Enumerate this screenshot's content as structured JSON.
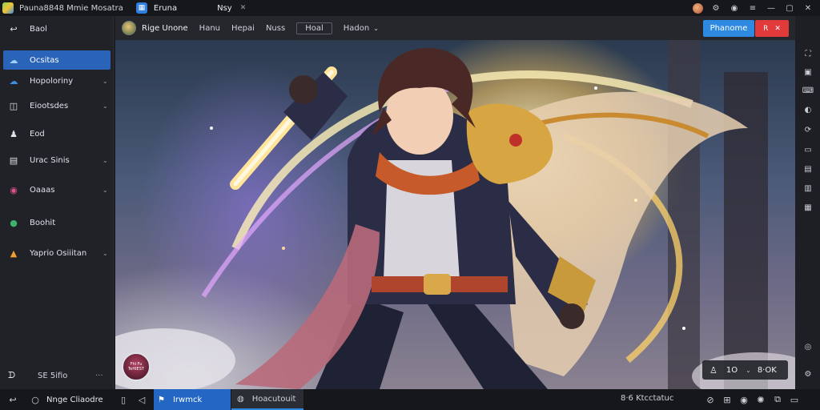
{
  "window": {
    "app_title": "Pauna8848 Mmie Mosatra",
    "tabs": [
      {
        "label": "Eruna",
        "active": true
      },
      {
        "label": "Nsy"
      }
    ]
  },
  "sidebar": {
    "items": [
      {
        "label": "Baol",
        "icon": "back-arrow-icon"
      },
      {
        "label": "Ocsitas",
        "icon": "cloud-icon",
        "active": true
      },
      {
        "label": "Hopoloriny",
        "icon": "cloud-icon",
        "chevron": true
      },
      {
        "label": "Eiootsdes",
        "icon": "chat-icon",
        "chevron": true
      },
      {
        "label": "Eod",
        "icon": "person-icon"
      },
      {
        "label": "Urac Sinis",
        "icon": "book-icon",
        "chevron": true
      },
      {
        "label": "Oaaas",
        "icon": "ring-icon",
        "chevron": true
      },
      {
        "label": "Boohit",
        "icon": "green-circle-icon"
      },
      {
        "label": "Yaprio Osiiitan",
        "icon": "flame-icon",
        "chevron": true
      }
    ],
    "footer": {
      "label": "SE 5ifio",
      "more": "···"
    }
  },
  "toolbar": {
    "game_title": "Rige Unone",
    "links": [
      "Hanu",
      "Hepai",
      "Nuss"
    ],
    "box_label": "Hoal",
    "menu_label": "Hadon",
    "primary_button": "Phanome",
    "red_button": "R"
  },
  "viewport": {
    "avatar_text": "Fhl Fu TeHIEST",
    "overlay": {
      "count": "1O",
      "label": "8·OK"
    }
  },
  "bottombar": {
    "left_label": "Nnge Cliaodre",
    "task1": "Irwmck",
    "task2": "Hoacutouit",
    "status": "8·6 Ktcctatuc",
    "colors": {
      "accent": "#2d8ae0",
      "active_task": "#2366c4",
      "danger": "#e03a3a"
    }
  }
}
